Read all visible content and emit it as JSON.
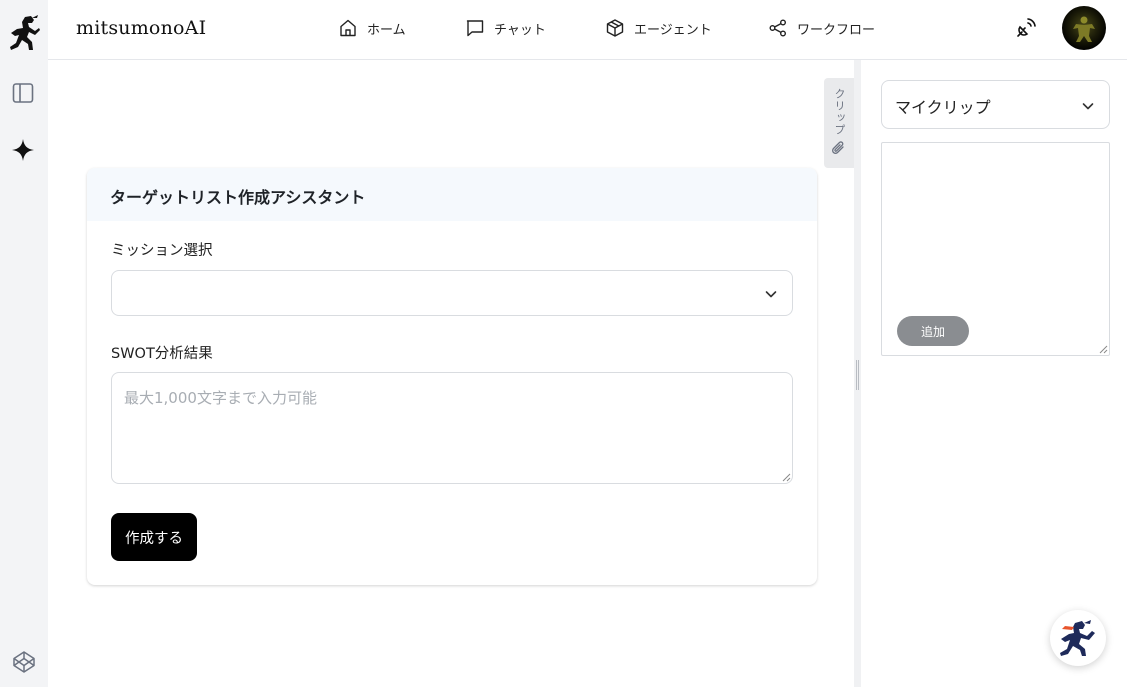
{
  "app": {
    "brand": "mitsumonoAI"
  },
  "nav": {
    "home": "ホーム",
    "chat": "チャット",
    "agent": "エージェント",
    "workflow": "ワークフロー"
  },
  "card": {
    "title": "ターゲットリスト作成アシスタント",
    "mission_label": "ミッション選択",
    "mission_value": "",
    "swot_label": "SWOT分析結果",
    "swot_placeholder": "最大1,000文字まで入力可能",
    "submit_label": "作成する"
  },
  "clip_tab": {
    "label": "クリップ"
  },
  "right_panel": {
    "select_value": "マイクリップ",
    "add_label": "追加"
  },
  "icons": {
    "logo": "ninja-logo-icon",
    "sidebar": "sidebar-toggle-icon",
    "sparkle": "sparkle-icon",
    "codepen": "codepen-icon",
    "home": "home-icon",
    "chat": "chat-bubble-icon",
    "agent": "package-icon",
    "workflow": "share-nodes-icon",
    "signal": "satellite-signal-icon",
    "clip": "paperclip-icon",
    "chevron": "chevron-down-icon"
  }
}
